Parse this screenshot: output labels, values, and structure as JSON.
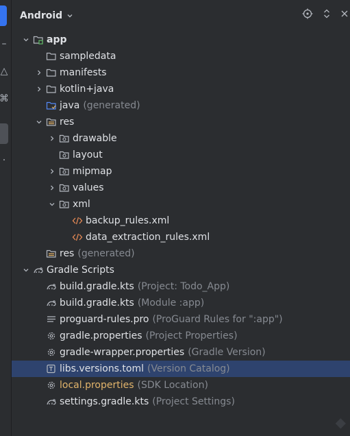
{
  "header": {
    "title": "Android"
  },
  "tree": [
    {
      "label": "app",
      "hint": "",
      "depth": 0,
      "chevron": "down",
      "icon": "module-folder-icon",
      "bold": true
    },
    {
      "label": "sampledata",
      "hint": "",
      "depth": 1,
      "chevron": "",
      "icon": "folder-icon"
    },
    {
      "label": "manifests",
      "hint": "",
      "depth": 1,
      "chevron": "right",
      "icon": "folder-icon"
    },
    {
      "label": "kotlin+java",
      "hint": "",
      "depth": 1,
      "chevron": "right",
      "icon": "folder-icon"
    },
    {
      "label": "java",
      "hint": "(generated)",
      "depth": 1,
      "chevron": "",
      "icon": "generated-source-folder-icon"
    },
    {
      "label": "res",
      "hint": "",
      "depth": 1,
      "chevron": "down",
      "icon": "resource-folder-icon"
    },
    {
      "label": "drawable",
      "hint": "",
      "depth": 2,
      "chevron": "right",
      "icon": "package-folder-icon"
    },
    {
      "label": "layout",
      "hint": "",
      "depth": 2,
      "chevron": "",
      "icon": "package-folder-icon"
    },
    {
      "label": "mipmap",
      "hint": "",
      "depth": 2,
      "chevron": "right",
      "icon": "package-folder-icon"
    },
    {
      "label": "values",
      "hint": "",
      "depth": 2,
      "chevron": "right",
      "icon": "package-folder-icon"
    },
    {
      "label": "xml",
      "hint": "",
      "depth": 2,
      "chevron": "down",
      "icon": "package-folder-icon"
    },
    {
      "label": "backup_rules.xml",
      "hint": "",
      "depth": 3,
      "chevron": "",
      "icon": "xml-file-icon"
    },
    {
      "label": "data_extraction_rules.xml",
      "hint": "",
      "depth": 3,
      "chevron": "",
      "icon": "xml-file-icon"
    },
    {
      "label": "res",
      "hint": "(generated)",
      "depth": 1,
      "chevron": "",
      "icon": "resource-folder-icon"
    },
    {
      "label": "Gradle Scripts",
      "hint": "",
      "depth": 0,
      "chevron": "down",
      "icon": "gradle-icon"
    },
    {
      "label": "build.gradle.kts",
      "hint": "(Project: Todo_App)",
      "depth": 1,
      "chevron": "",
      "icon": "gradle-icon"
    },
    {
      "label": "build.gradle.kts",
      "hint": "(Module :app)",
      "depth": 1,
      "chevron": "",
      "icon": "gradle-icon"
    },
    {
      "label": "proguard-rules.pro",
      "hint": "(ProGuard Rules for \":app\")",
      "depth": 1,
      "chevron": "",
      "icon": "text-file-icon"
    },
    {
      "label": "gradle.properties",
      "hint": "(Project Properties)",
      "depth": 1,
      "chevron": "",
      "icon": "gear-icon"
    },
    {
      "label": "gradle-wrapper.properties",
      "hint": "(Gradle Version)",
      "depth": 1,
      "chevron": "",
      "icon": "gear-icon"
    },
    {
      "label": "libs.versions.toml",
      "hint": "(Version Catalog)",
      "depth": 1,
      "chevron": "",
      "icon": "toml-file-icon",
      "selected": true
    },
    {
      "label": "local.properties",
      "hint": "(SDK Location)",
      "depth": 1,
      "chevron": "",
      "icon": "gear-icon",
      "orange": true
    },
    {
      "label": "settings.gradle.kts",
      "hint": "(Project Settings)",
      "depth": 1,
      "chevron": "",
      "icon": "gradle-icon"
    }
  ]
}
